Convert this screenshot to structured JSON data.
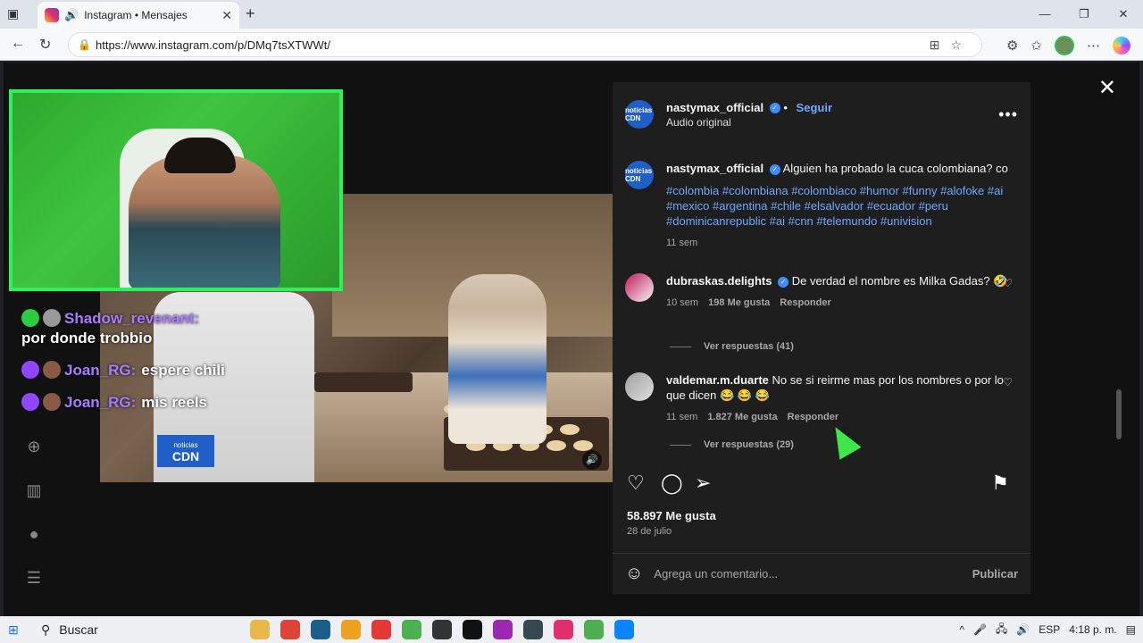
{
  "browser": {
    "tab_title": "Instagram • Mensajes",
    "url": "https://www.instagram.com/p/DMq7tsXTWWt/",
    "new_tab_glyph": "+",
    "tab_close_glyph": "✕"
  },
  "stream_chat": [
    {
      "nick": "Shadow_revenant:",
      "message": "por donde trobbio",
      "icon_color": "#2ecc40"
    },
    {
      "nick": "Joan_RG:",
      "message": "espere chili",
      "icon_color": "#9146ff"
    },
    {
      "nick": "Joan_RG:",
      "message": "mis reels",
      "icon_color": "#9146ff"
    }
  ],
  "video": {
    "badge_top": "noticias",
    "badge_main": "CDN"
  },
  "post": {
    "author": "nastymax_official",
    "follow_label": "Seguir",
    "separator": "•",
    "audio_label": "Audio original",
    "avatar_text": "noticias CDN",
    "caption_text": "Alguien ha probado la cuca colombiana? co",
    "hashtags": "#colombia #colombiana #colombiaco #humor #funny #alofoke #ai #mexico #argentina #chile #elsalvador #ecuador #peru #dominicanrepublic #ai #cnn #telemundo #univision",
    "caption_time": "11 sem",
    "likes": "58.897 Me gusta",
    "date": "28 de julio",
    "comment_placeholder": "Agrega un comentario...",
    "publish_label": "Publicar"
  },
  "comments": [
    {
      "user": "dubraskas.delights",
      "verified": true,
      "text": "De verdad el nombre es Milka Gadas? 🤣",
      "time": "10 sem",
      "likes": "198 Me gusta",
      "reply_label": "Responder",
      "view_replies": "Ver respuestas (41)"
    },
    {
      "user": "valdemar.m.duarte",
      "verified": false,
      "text": "No se si reirme mas por los nombres o por lo que dicen 😂 😂 😂",
      "time": "11 sem",
      "likes": "1.827 Me gusta",
      "reply_label": "Responder",
      "view_replies": "Ver respuestas (29)"
    }
  ],
  "taskbar": {
    "search_label": "Buscar",
    "language": "ESP",
    "time": "4:18 p. m."
  },
  "colors": {
    "accent_link": "#6ea8ff",
    "panel_bg": "#1e1e1e",
    "webcam_border": "#2ef05a",
    "chat_nick": "#a97cff"
  }
}
